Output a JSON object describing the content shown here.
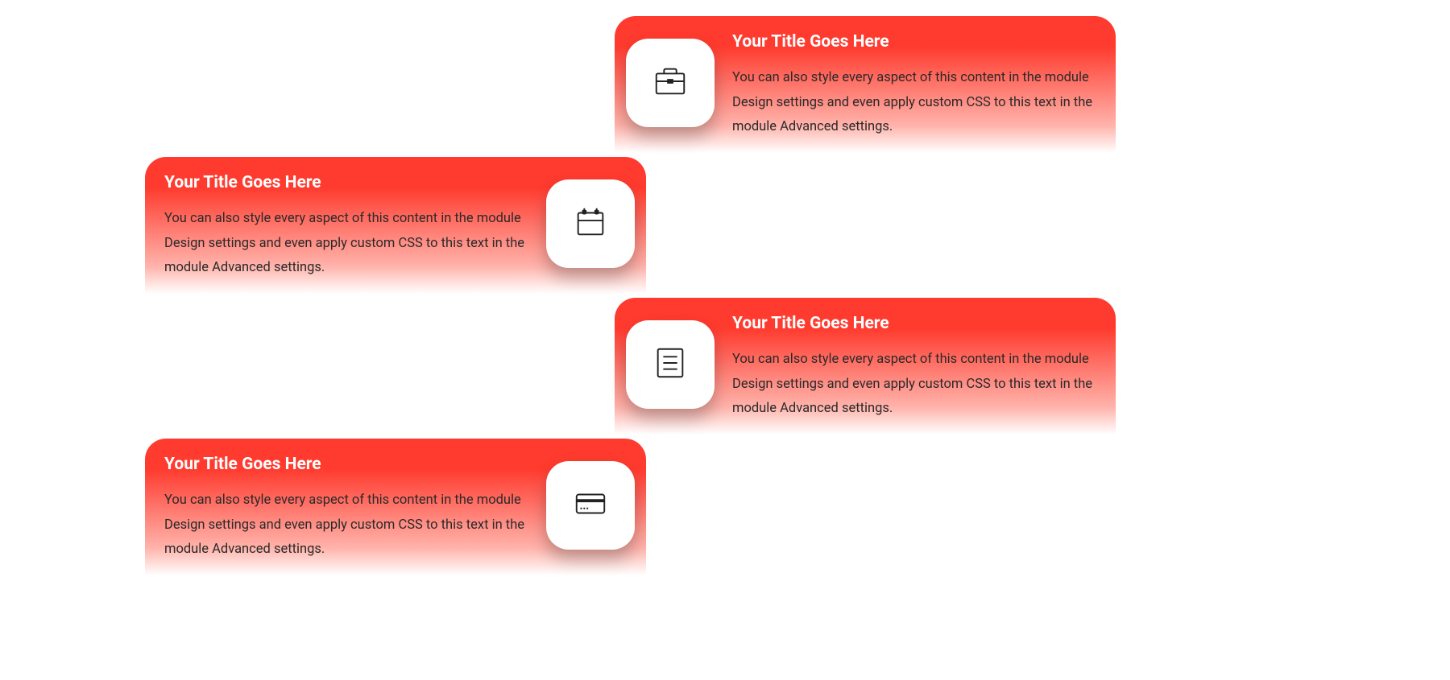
{
  "cards": [
    {
      "title": "Your Title Goes Here",
      "body": "You can also style every aspect of this content in the module Design settings and even apply custom CSS to this text in the module Advanced settings.",
      "icon": "briefcase"
    },
    {
      "title": "Your Title Goes Here",
      "body": "You can also style every aspect of this content in the module Design settings and even apply custom CSS to this text in the module Advanced settings.",
      "icon": "calendar"
    },
    {
      "title": "Your Title Goes Here",
      "body": "You can also style every aspect of this content in the module Design settings and even apply custom CSS to this text in the module Advanced settings.",
      "icon": "document"
    },
    {
      "title": "Your Title Goes Here",
      "body": "You can also style every aspect of this content in the module Design settings and even apply custom CSS to this text in the module Advanced settings.",
      "icon": "credit-card"
    }
  ]
}
